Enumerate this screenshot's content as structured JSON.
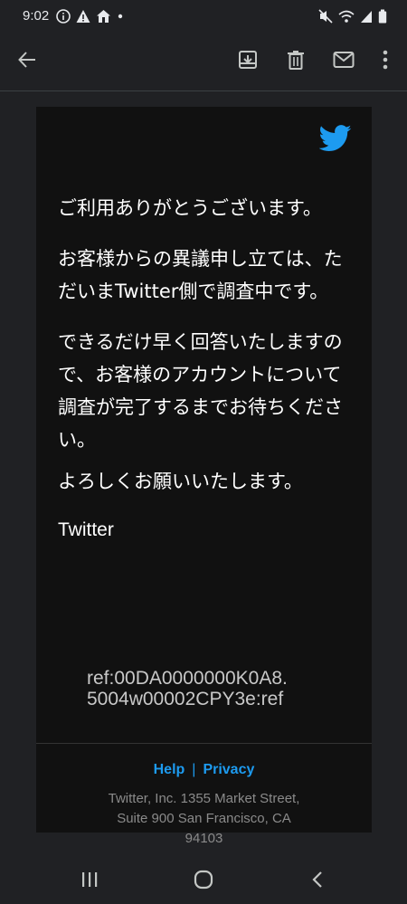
{
  "status_bar": {
    "time": "9:02",
    "left_icons": [
      "info-icon",
      "warning-icon",
      "home-icon",
      "dot-icon"
    ],
    "right_icons": [
      "mute-icon",
      "wifi-icon",
      "signal-icon",
      "battery-icon"
    ]
  },
  "toolbar": {
    "actions": [
      "back-arrow-icon",
      "archive-icon",
      "delete-icon",
      "mark-unread-icon",
      "more-vert-icon"
    ]
  },
  "email": {
    "brand_icon": "twitter-bird-icon",
    "brand_color": "#1d9bf0",
    "greeting": "ご利用ありがとうございます。",
    "para1": "お客様からの異議申し立ては、ただいまTwitter側で調査中です。",
    "para2": "できるだけ早く回答いたしますので、お客様のアカウントについて調査が完了するまでお待ちください。",
    "closing": "よろしくお願いいたします。",
    "signature": "Twitter",
    "ref_line1": "ref:00DA0000000K0A8.",
    "ref_line2": "5004w00002CPY3e:ref"
  },
  "footer": {
    "help_label": "Help",
    "separator": "|",
    "privacy_label": "Privacy",
    "address_line1": "Twitter, Inc. 1355 Market Street,",
    "address_line2": "Suite 900 San Francisco, CA",
    "address_line3": "94103"
  },
  "nav_bar": {
    "buttons": [
      "recent-apps-icon",
      "home-circle-icon",
      "back-chevron-icon"
    ]
  }
}
